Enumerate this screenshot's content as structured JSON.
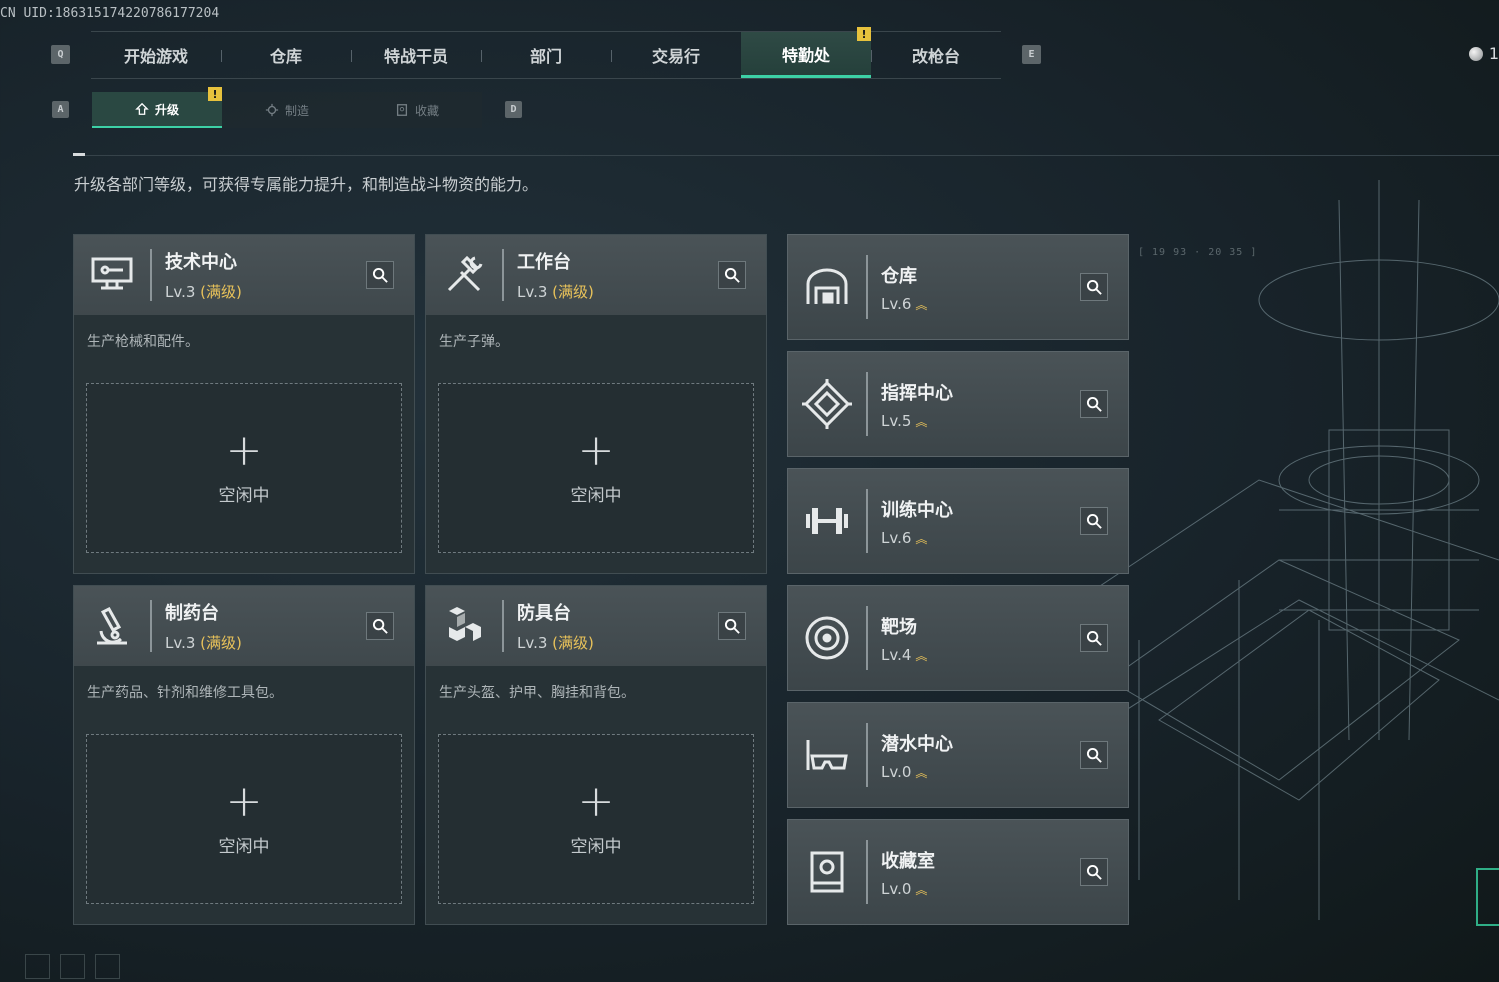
{
  "uid": "CN UID:18631517422078617720​4",
  "keys": {
    "q": "Q",
    "e": "E",
    "a": "A",
    "d": "D"
  },
  "main_tabs": [
    {
      "label": "开始游戏"
    },
    {
      "label": "仓库"
    },
    {
      "label": "特战干员"
    },
    {
      "label": "部门"
    },
    {
      "label": "交易行"
    },
    {
      "label": "特勤处",
      "active": true,
      "warning": true
    },
    {
      "label": "改枪台"
    }
  ],
  "currency": {
    "value": "1"
  },
  "sub_tabs": [
    {
      "label": "升级",
      "icon": "upgrade-icon",
      "active": true,
      "warning": true
    },
    {
      "label": "制造",
      "icon": "gear-icon"
    },
    {
      "label": "收藏",
      "icon": "collection-icon"
    }
  ],
  "warning_mark": "!",
  "description": "升级各部门等级，可获得专属能力提升，和制造战斗物资的能力。",
  "bracket_text": "[ 19 93 · 20 35 ]",
  "craft_cards": [
    {
      "title": "技术中心",
      "level": "Lv.3",
      "max": "(满级)",
      "desc": "生产枪械和配件。",
      "idle": "空闲中",
      "icon": "computer-icon"
    },
    {
      "title": "工作台",
      "level": "Lv.3",
      "max": "(满级)",
      "desc": "生产子弹。",
      "idle": "空闲中",
      "icon": "hammer-wrench-icon"
    },
    {
      "title": "制药台",
      "level": "Lv.3",
      "max": "(满级)",
      "desc": "生产药品、针剂和维修工具包。",
      "idle": "空闲中",
      "icon": "microscope-icon"
    },
    {
      "title": "防具台",
      "level": "Lv.3",
      "max": "(满级)",
      "desc": "生产头盔、护甲、胸挂和背包。",
      "idle": "空闲中",
      "icon": "cubes-icon"
    }
  ],
  "dept_cards": [
    {
      "title": "仓库",
      "level": "Lv.6",
      "icon": "warehouse-icon"
    },
    {
      "title": "指挥中心",
      "level": "Lv.5",
      "icon": "command-icon"
    },
    {
      "title": "训练中心",
      "level": "Lv.6",
      "icon": "dumbbell-icon"
    },
    {
      "title": "靶场",
      "level": "Lv.4",
      "icon": "target-icon"
    },
    {
      "title": "潜水中心",
      "level": "Lv.0",
      "icon": "diving-mask-icon"
    },
    {
      "title": "收藏室",
      "level": "Lv.0",
      "icon": "display-case-icon"
    }
  ],
  "upgrade_chevron": "︽",
  "plus_sign": "+"
}
